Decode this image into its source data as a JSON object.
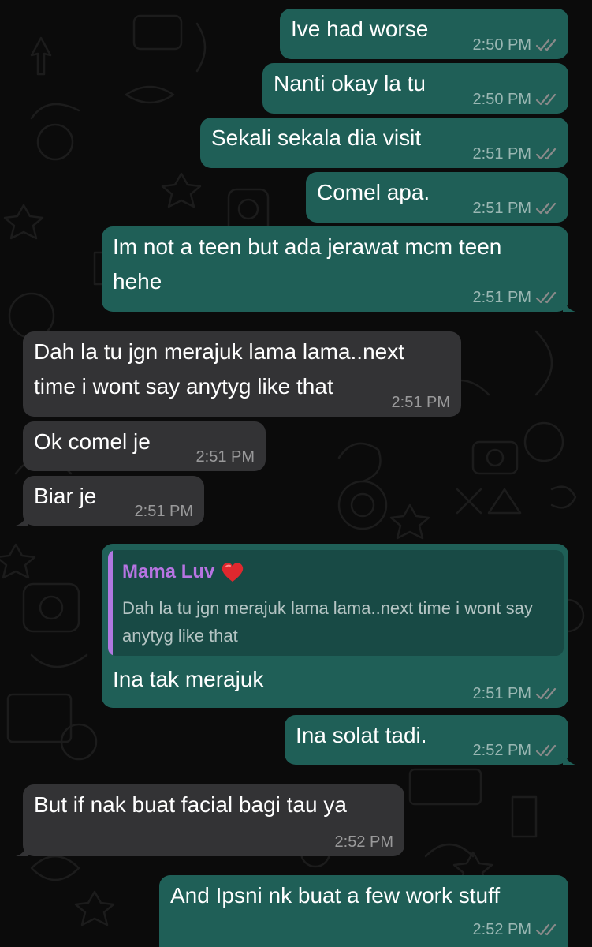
{
  "messages": [
    {
      "dir": "out",
      "text": "Ive had worse",
      "time": "2:50 PM"
    },
    {
      "dir": "out",
      "text": "Nanti okay la tu",
      "time": "2:50 PM"
    },
    {
      "dir": "out",
      "text": "Sekali sekala dia visit",
      "time": "2:51 PM"
    },
    {
      "dir": "out",
      "text": "Comel apa.",
      "time": "2:51 PM"
    },
    {
      "dir": "out",
      "text": "Im not a teen but ada jerawat mcm teen\nhehe",
      "time": "2:51 PM"
    },
    {
      "dir": "in",
      "text": "Dah la tu jgn merajuk lama lama..next\ntime i wont say anytyg like that",
      "time": "2:51 PM"
    },
    {
      "dir": "in",
      "text": "Ok comel je",
      "time": "2:51 PM"
    },
    {
      "dir": "in",
      "text": "Biar je",
      "time": "2:51 PM"
    },
    {
      "dir": "out",
      "text": "Ina tak merajuk",
      "time": "2:51 PM",
      "quote": {
        "sender": "Mama Luv",
        "sender_emoji": "❤️",
        "text": "Dah la tu jgn merajuk lama lama..next time i wont say anytyg like that"
      }
    },
    {
      "dir": "out",
      "text": "Ina solat tadi.",
      "time": "2:52 PM"
    },
    {
      "dir": "in",
      "text": "But if nak buat facial bagi tau ya",
      "time": "2:52 PM"
    },
    {
      "dir": "out",
      "text": "And Ipsni nk buat a few work stuff",
      "time": "2:52 PM"
    }
  ],
  "colors": {
    "background": "#0b0b0b",
    "outgoing_bubble": "#1f5f57",
    "incoming_bubble": "#333335",
    "quote_sender": "#b774e2",
    "read_ticks": "#8a8a8a"
  },
  "icons": {
    "read_status": "double-check-icon",
    "sender_emoji": "heart-emoji"
  }
}
